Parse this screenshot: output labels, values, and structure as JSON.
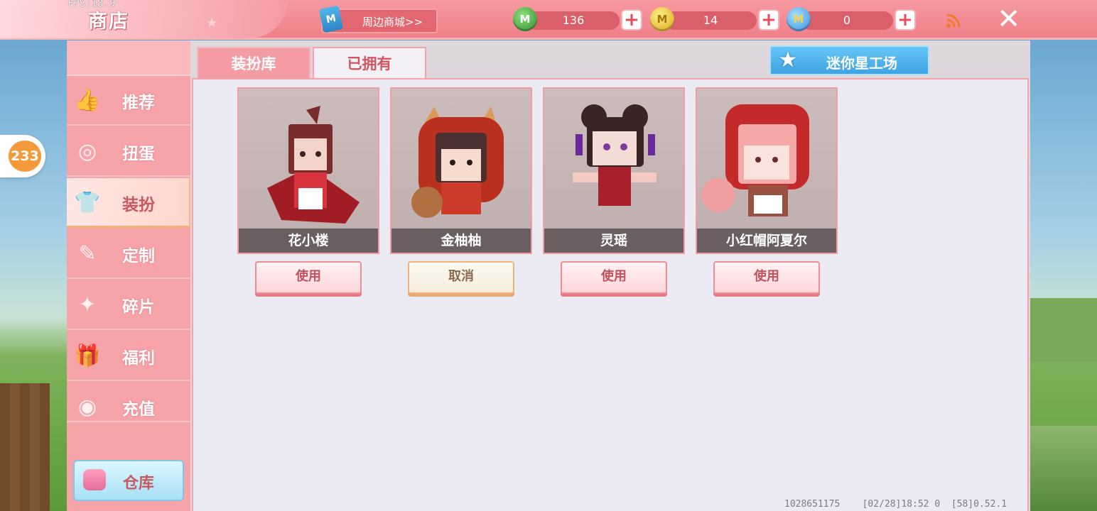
{
  "app": {
    "title": "商店",
    "fps": "FPS:18.9"
  },
  "header": {
    "mall_label": "周边商城>>",
    "mall_icon_letter": "M",
    "currencies": [
      {
        "icon": "green-mini-coin-icon",
        "value": "136",
        "color": "#3aa63a"
      },
      {
        "icon": "gold-mini-coin-icon",
        "value": "14",
        "color": "#e2b21a"
      },
      {
        "icon": "blue-mini-coin-icon",
        "value": "0",
        "color": "#3a96dd"
      }
    ]
  },
  "side_badge": "233",
  "sidebar": {
    "items": [
      {
        "label": "推荐",
        "icon": "thumbs-up-icon"
      },
      {
        "label": "扭蛋",
        "icon": "capsule-icon"
      },
      {
        "label": "装扮",
        "icon": "shirt-icon",
        "active": true
      },
      {
        "label": "定制",
        "icon": "pencil-ruler-icon"
      },
      {
        "label": "碎片",
        "icon": "puzzle-piece-icon"
      },
      {
        "label": "福利",
        "icon": "gift-icon"
      },
      {
        "label": "充值",
        "icon": "coin-stack-icon"
      }
    ],
    "warehouse_label": "仓库"
  },
  "tabs": [
    {
      "label": "装扮库",
      "selected": false
    },
    {
      "label": "已拥有",
      "selected": true
    }
  ],
  "studio_label": "迷你星工场",
  "skins": [
    {
      "name": "花小楼",
      "action": "使用"
    },
    {
      "name": "金柚柚",
      "action": "取消"
    },
    {
      "name": "灵瑶",
      "action": "使用"
    },
    {
      "name": "小红帽阿夏尔",
      "action": "使用"
    }
  ],
  "footer": {
    "uid": "1028651175",
    "time": "[02/28]18:52 0",
    "version": "[58]0.52.1"
  }
}
